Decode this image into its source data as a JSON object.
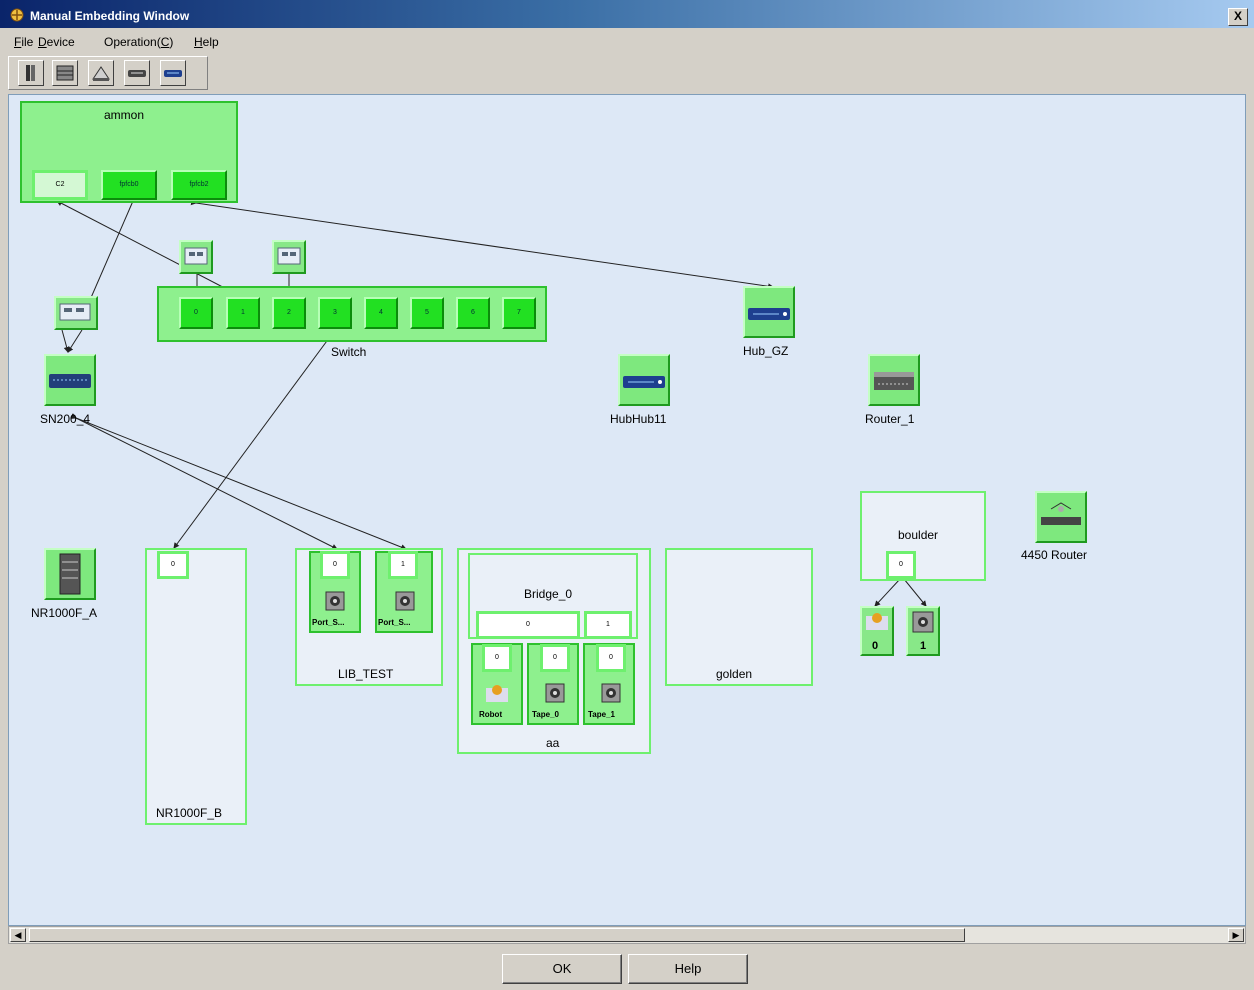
{
  "window": {
    "title": "Manual Embedding Window",
    "close": "X"
  },
  "menu": [
    {
      "pre": "",
      "key": "F",
      "post": "ile"
    },
    {
      "pre": "",
      "key": "D",
      "post": "evice"
    },
    {
      "pre": "Operation(",
      "key": "C",
      "post": ")"
    },
    {
      "pre": "",
      "key": "H",
      "post": "elp"
    }
  ],
  "toolbar": [
    "host-icon",
    "storage-icon",
    "tape-icon",
    "switch-icon",
    "hub-icon"
  ],
  "nodes": {
    "ammon": {
      "label": "ammon",
      "ports": [
        "C2",
        "fpfcb0",
        "fpfcb2"
      ]
    },
    "switch": {
      "label": "Switch",
      "ports": [
        "0",
        "1",
        "2",
        "3",
        "4",
        "5",
        "6",
        "7"
      ]
    },
    "hub_gz": {
      "label": "Hub_GZ"
    },
    "sn200": {
      "label": "SN200_4"
    },
    "hubhub11": {
      "label": "HubHub11"
    },
    "router1": {
      "label": "Router_1"
    },
    "boulder": {
      "label": "boulder",
      "port": "0",
      "children": [
        "0",
        "1"
      ]
    },
    "router4450": {
      "label": "4450 Router"
    },
    "nr1000f_a": {
      "label": "NR1000F_A"
    },
    "nr1000f_b": {
      "label": "NR1000F_B",
      "port": "0"
    },
    "lib_test": {
      "label": "LIB_TEST",
      "ports": [
        "0",
        "1"
      ],
      "devices": [
        "Port_S...",
        "Port_S..."
      ]
    },
    "aa": {
      "label": "aa",
      "bridge": {
        "label": "Bridge_0",
        "ports": [
          "0",
          "1"
        ]
      },
      "ports": [
        "0",
        "0",
        "0"
      ],
      "devices": [
        "Robot",
        "Tape_0",
        "Tape_1"
      ]
    },
    "golden": {
      "label": "golden"
    }
  },
  "buttons": {
    "ok": "OK",
    "help": "Help"
  },
  "colors": {
    "canvas": "#dde8f6",
    "node_green": "#22e022",
    "container_border": "#6ef06e"
  }
}
